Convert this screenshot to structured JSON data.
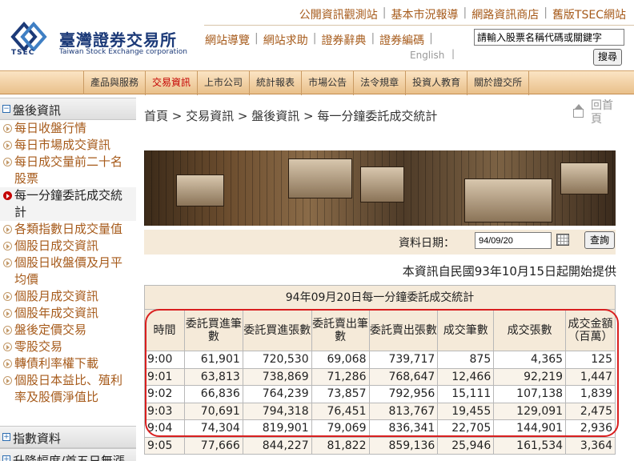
{
  "header": {
    "logo_cn": "臺灣證券交易所",
    "logo_en": "Taiwan Stock Exchange corporation",
    "logo_abbr": "TSEC",
    "top_links": [
      "公開資訊觀測站",
      "基本市況報導",
      "網路資訊商店",
      "舊版TSEC網站"
    ],
    "mid_links": [
      "網站導覽",
      "網站求助",
      "證券辭典",
      "證券編碼"
    ],
    "english": "English",
    "search_placeholder": "請輸入股票名稱代碼或關鍵字",
    "search_button": "搜尋"
  },
  "nav": {
    "items": [
      {
        "label": "產品與服務",
        "active": false
      },
      {
        "label": "交易資訊",
        "active": true
      },
      {
        "label": "上市公司",
        "active": false
      },
      {
        "label": "統計報表",
        "active": false
      },
      {
        "label": "市場公告",
        "active": false
      },
      {
        "label": "法令規章",
        "active": false
      },
      {
        "label": "投資人教育",
        "active": false
      },
      {
        "label": "關於證交所",
        "active": false
      }
    ]
  },
  "sidebar": {
    "section1": {
      "label": "盤後資訊",
      "expand_glyph": "−"
    },
    "items": [
      "每日收盤行情",
      "每日市場成交資訊",
      "每日成交量前二十名股票",
      "每一分鐘委託成交統計",
      "各類指數日成交量值",
      "個股日成交資訊",
      "個股日收盤價及月平均價",
      "個股月成交資訊",
      "個股年成交資訊",
      "盤後定價交易",
      "零股交易",
      "轉債利率權下載",
      "個股日本益比、殖利率及股價淨值比"
    ],
    "active_index": 3,
    "section2": {
      "label": "指數資料",
      "expand_glyph": "+"
    },
    "section3_partial": "升降幅度/首五日無漲"
  },
  "main": {
    "breadcrumb": "首頁 > 交易資訊 > 盤後資訊 > 每一分鐘委託成交統計",
    "back_home": "回首頁",
    "date_label": "資料日期：",
    "date_value": "94/09/20",
    "query_button": "查詢",
    "note": "本資訊自民國93年10月15日起開始提供"
  },
  "table": {
    "caption": "94年09月20日每一分鐘委託成交統計",
    "headers": [
      "時間",
      "委託買進筆數",
      "委託買進張數",
      "委託賣出筆數",
      "委託賣出張數",
      "成交筆數",
      "成交張數",
      "成交金額（百萬）"
    ],
    "rows": [
      [
        "9:00",
        "61,901",
        "720,530",
        "69,068",
        "739,717",
        "875",
        "4,365",
        "125"
      ],
      [
        "9:01",
        "63,813",
        "738,869",
        "71,286",
        "768,647",
        "12,466",
        "92,219",
        "1,447"
      ],
      [
        "9:02",
        "66,836",
        "764,239",
        "73,857",
        "792,956",
        "15,111",
        "107,138",
        "1,839"
      ],
      [
        "9:03",
        "70,691",
        "794,318",
        "76,451",
        "813,767",
        "19,455",
        "129,091",
        "2,475"
      ],
      [
        "9:04",
        "74,304",
        "819,901",
        "79,069",
        "836,341",
        "22,705",
        "144,901",
        "2,936"
      ],
      [
        "9:05",
        "77,666",
        "844,227",
        "81,822",
        "859,136",
        "25,946",
        "161,534",
        "3,364"
      ]
    ]
  },
  "colors": {
    "link": "#a65a1a",
    "active_nav": "#c40000",
    "highlight_outline": "#d91f1f",
    "table_header_bg": "#f5ead9"
  }
}
